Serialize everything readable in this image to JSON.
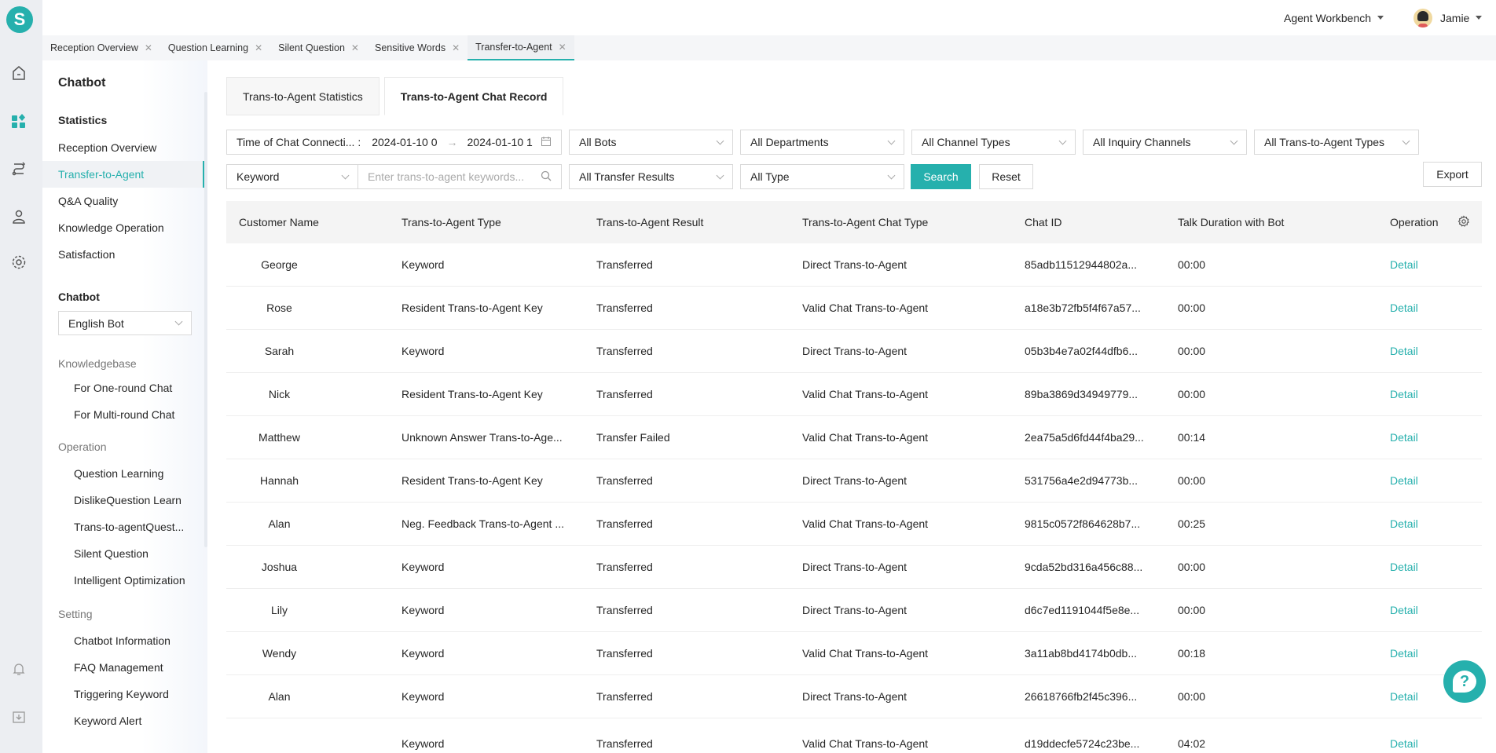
{
  "app": {
    "logo_letter": "S",
    "accent": "#26b0ad"
  },
  "header": {
    "workbench": "Agent Workbench",
    "user": "Jamie"
  },
  "tabs": [
    {
      "label": "Reception Overview"
    },
    {
      "label": "Question Learning"
    },
    {
      "label": "Silent Question"
    },
    {
      "label": "Sensitive Words"
    },
    {
      "label": "Transfer-to-Agent",
      "active": true
    }
  ],
  "rail": {
    "icons": [
      "home-icon",
      "apps-icon",
      "route-icon",
      "agent-icon",
      "gear-icon",
      "bell-icon",
      "download-icon"
    ]
  },
  "sidebar": {
    "title": "Chatbot",
    "statistics_head": "Statistics",
    "statistics": [
      "Reception Overview",
      "Transfer-to-Agent",
      "Q&A Quality",
      "Knowledge Operation",
      "Satisfaction"
    ],
    "chatbot_head": "Chatbot",
    "bot_select": "English Bot",
    "knowledgebase": "Knowledgebase",
    "kb_items": [
      "For One-round Chat",
      "For Multi-round Chat"
    ],
    "operation": "Operation",
    "op_items": [
      "Question Learning",
      "DislikeQuestion Learn",
      "Trans-to-agentQuest...",
      "Silent Question",
      "Intelligent Optimization"
    ],
    "setting": "Setting",
    "set_items": [
      "Chatbot Information",
      "FAQ Management",
      "Triggering Keyword",
      "Keyword Alert"
    ]
  },
  "content_tabs": [
    "Trans-to-Agent Statistics",
    "Trans-to-Agent Chat Record"
  ],
  "filters": {
    "time_label": "Time of Chat Connecti... :",
    "start": "2024-01-10 0",
    "arrow": "→",
    "end": "2024-01-10 1",
    "bots": "All Bots",
    "departments": "All Departments",
    "channel_types": "All Channel Types",
    "inquiry_channels": "All Inquiry Channels",
    "transfer_types": "All Trans-to-Agent Types",
    "keyword_select": "Keyword",
    "keyword_placeholder": "Enter trans-to-agent keywords...",
    "transfer_results": "All Transfer Results",
    "type": "All Type",
    "search": "Search",
    "reset": "Reset",
    "export": "Export"
  },
  "table": {
    "columns": [
      "Customer Name",
      "Trans-to-Agent Type",
      "Trans-to-Agent Result",
      "Trans-to-Agent Chat Type",
      "Chat ID",
      "Talk Duration with Bot",
      "Operation"
    ],
    "rows": [
      [
        "George",
        "Keyword",
        "Transferred",
        "Direct Trans-to-Agent",
        "85adb11512944802a...",
        "00:00",
        "Detail"
      ],
      [
        "Rose",
        "Resident Trans-to-Agent Key",
        "Transferred",
        "Valid Chat Trans-to-Agent",
        "a18e3b72fb5f4f67a57...",
        "00:00",
        "Detail"
      ],
      [
        "Sarah",
        "Keyword",
        "Transferred",
        "Direct Trans-to-Agent",
        "05b3b4e7a02f44dfb6...",
        "00:00",
        "Detail"
      ],
      [
        "Nick",
        "Resident Trans-to-Agent Key",
        "Transferred",
        "Valid Chat Trans-to-Agent",
        "89ba3869d34949779...",
        "00:00",
        "Detail"
      ],
      [
        "Matthew",
        "Unknown Answer Trans-to-Age...",
        "Transfer Failed",
        "Valid Chat Trans-to-Agent",
        "2ea75a5d6fd44f4ba29...",
        "00:14",
        "Detail"
      ],
      [
        "Hannah",
        "Resident Trans-to-Agent Key",
        "Transferred",
        "Direct Trans-to-Agent",
        "531756a4e2d94773b...",
        "00:00",
        "Detail"
      ],
      [
        "Alan",
        "Neg. Feedback Trans-to-Agent ...",
        "Transferred",
        "Valid Chat Trans-to-Agent",
        "9815c0572f864628b7...",
        "00:25",
        "Detail"
      ],
      [
        "Joshua",
        "Keyword",
        "Transferred",
        "Direct Trans-to-Agent",
        "9cda52bd316a456c88...",
        "00:00",
        "Detail"
      ],
      [
        "Lily",
        "Keyword",
        "Transferred",
        "Direct Trans-to-Agent",
        "d6c7ed1191044f5e8e...",
        "00:00",
        "Detail"
      ],
      [
        "Wendy",
        "Keyword",
        "Transferred",
        "Valid Chat Trans-to-Agent",
        "3a11ab8bd4174b0db...",
        "00:18",
        "Detail"
      ],
      [
        "Alan",
        "Keyword",
        "Transferred",
        "Direct Trans-to-Agent",
        "26618766fb2f45c396...",
        "00:00",
        "Detail"
      ],
      [
        "",
        "Keyword",
        "Transferred",
        "Valid Chat Trans-to-Agent",
        "d19ddecfe5724c23be...",
        "04:02",
        "Detail"
      ]
    ]
  },
  "help": {
    "glyph": "?"
  }
}
